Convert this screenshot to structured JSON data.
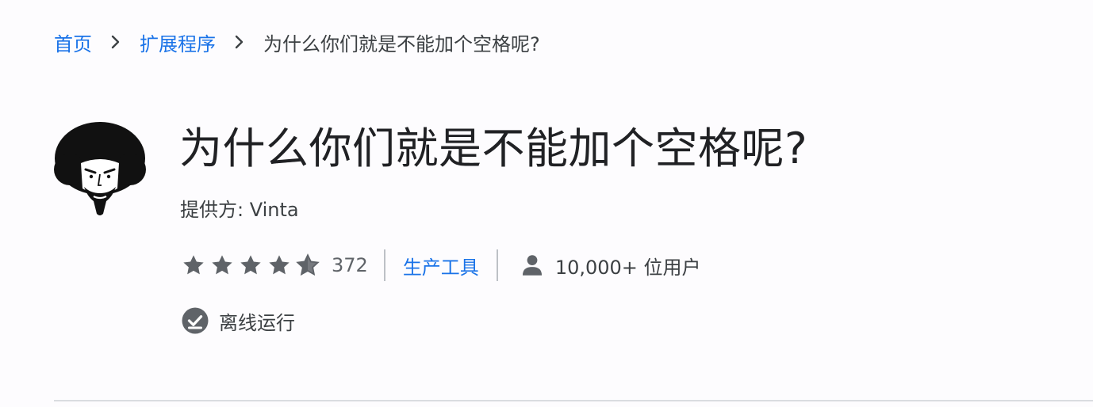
{
  "breadcrumb": {
    "home": "首页",
    "extensions": "扩展程序",
    "current": "为什么你们就是不能加个空格呢?"
  },
  "extension": {
    "title": "为什么你们就是不能加个空格呢?",
    "provider_label": "提供方:",
    "provider_name": "Vinta",
    "rating_stars": 4.5,
    "rating_max": 5,
    "rating_count": "372",
    "category": "生产工具",
    "users": "10,000+ 位用户",
    "offline": "离线运行"
  },
  "colors": {
    "link": "#1a73e8",
    "text": "#3c4043",
    "title": "#202124",
    "star": "#5f6368",
    "icon": "#5f6368",
    "background": "#fdfcfe"
  },
  "icons": {
    "breadcrumb_separator": "chevron-right-icon",
    "avatar": "afro-face-avatar",
    "star": "star-icon",
    "users": "person-icon",
    "offline": "offline-check-icon"
  }
}
